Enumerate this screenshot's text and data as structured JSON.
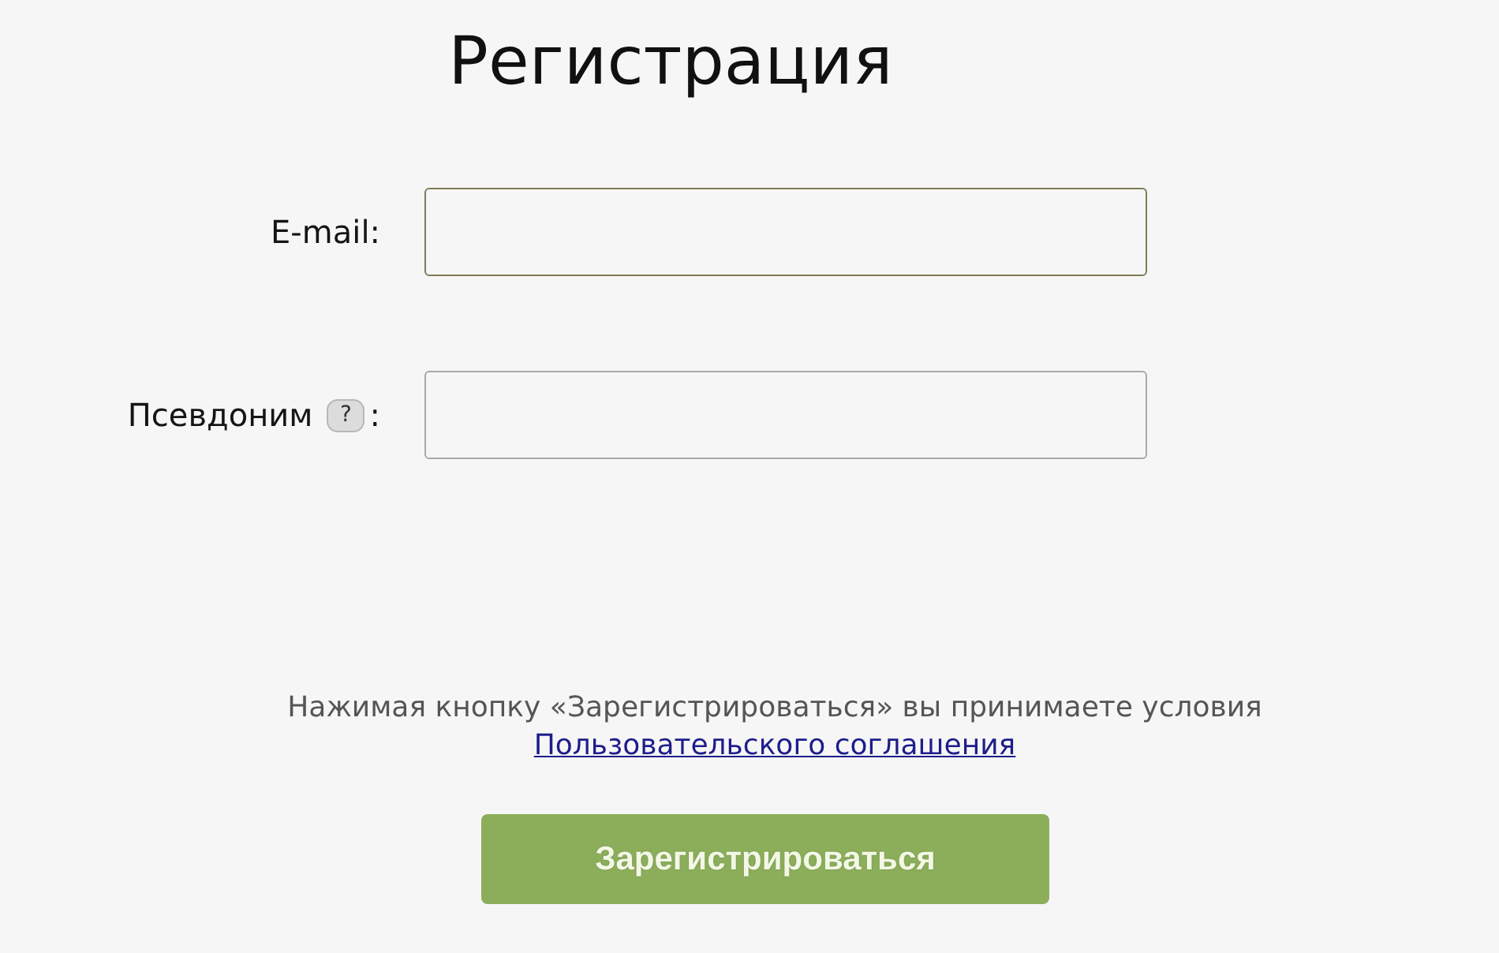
{
  "title": "Регистрация",
  "fields": [
    {
      "label": "E-mail:",
      "focused": true
    },
    {
      "label": "Псевдоним",
      "help": "?",
      "label_suffix": ":",
      "focused": false
    }
  ],
  "agreement": {
    "text": "Нажимая кнопку «Зарегистрироваться» вы принимаете условия",
    "link": "Пользовательского соглашения"
  },
  "submit_button": "Зарегистрироваться"
}
